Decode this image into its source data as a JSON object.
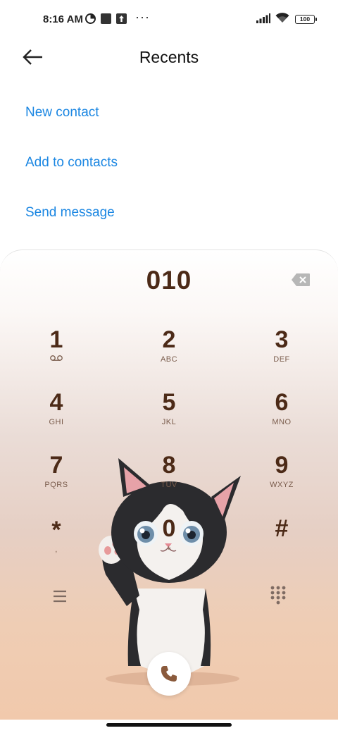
{
  "status_bar": {
    "time": "8:16 AM",
    "battery": "100",
    "more": "···"
  },
  "header": {
    "title": "Recents"
  },
  "actions": {
    "new_contact": "New contact",
    "add_to_contacts": "Add to contacts",
    "send_message": "Send message"
  },
  "dialer": {
    "number": "010",
    "keys": [
      {
        "num": "1",
        "sub": ""
      },
      {
        "num": "2",
        "sub": "ABC"
      },
      {
        "num": "3",
        "sub": "DEF"
      },
      {
        "num": "4",
        "sub": "GHI"
      },
      {
        "num": "5",
        "sub": "JKL"
      },
      {
        "num": "6",
        "sub": "MNO"
      },
      {
        "num": "7",
        "sub": "PQRS"
      },
      {
        "num": "8",
        "sub": "TUV"
      },
      {
        "num": "9",
        "sub": "WXYZ"
      },
      {
        "num": "*",
        "sub": ","
      },
      {
        "num": "0",
        "sub": "+"
      },
      {
        "num": "#",
        "sub": ""
      }
    ]
  },
  "colors": {
    "accent": "#1a86e2",
    "digit": "#4c2a17"
  }
}
